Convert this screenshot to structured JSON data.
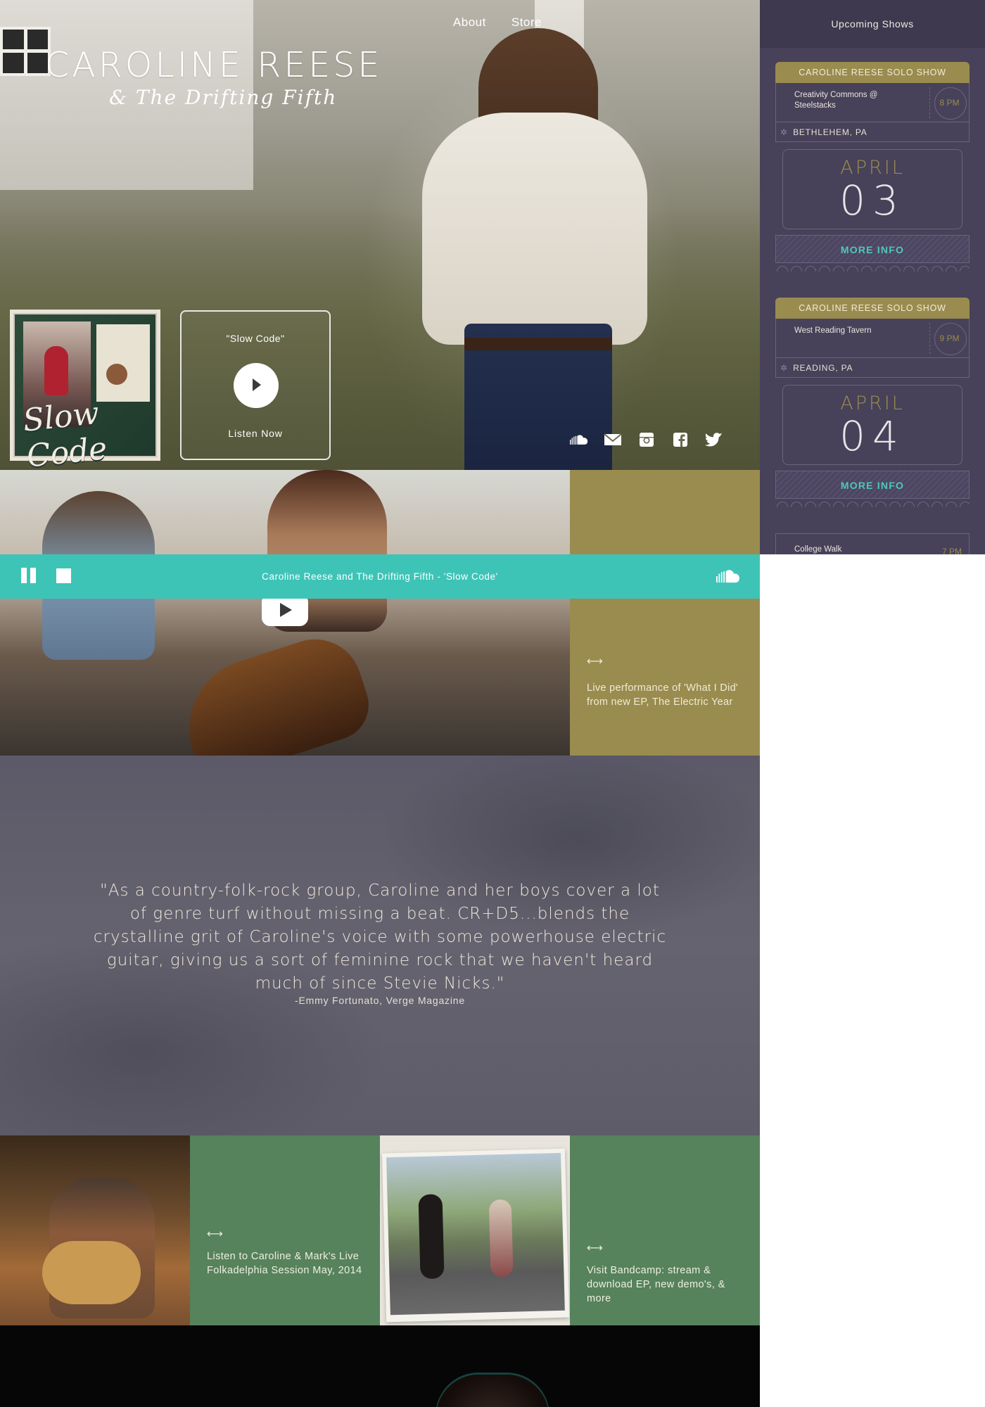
{
  "nav": {
    "about": "About",
    "store": "Store"
  },
  "site": {
    "title": "CAROLINE REESE",
    "subtitle": "& The Drifting Fifth"
  },
  "album": {
    "script_title": "Slow Code"
  },
  "listen": {
    "song": "\"Slow Code\"",
    "cta": "Listen Now"
  },
  "social": [
    "soundcloud-icon",
    "mail-icon",
    "instagram-icon",
    "facebook-icon",
    "twitter-icon"
  ],
  "sidebar": {
    "title": "Upcoming Shows",
    "shows": [
      {
        "band": "CAROLINE REESE SOLO SHOW",
        "venue": "Creativity Commons @ Steelstacks",
        "time": "8 PM",
        "city": "BETHLEHEM, PA",
        "month": "APRIL",
        "day": "03",
        "more": "MORE INFO"
      },
      {
        "band": "CAROLINE REESE SOLO SHOW",
        "venue": "West Reading Tavern",
        "time": "9 PM",
        "city": "READING, PA",
        "month": "APRIL",
        "day": "04",
        "more": "MORE INFO"
      }
    ],
    "partial": {
      "venue": "College Walk",
      "time": "7 PM"
    }
  },
  "player": {
    "track": "Caroline Reese and The Drifting Fifth  -  'Slow Code'"
  },
  "video_caption": {
    "arrow": "⟷",
    "text": "Live performance of 'What I Did' from new EP, The Electric Year"
  },
  "quote": {
    "text": "\"As a country-folk-rock group, Caroline and her boys cover a lot of genre turf without missing a beat.  CR+D5...blends the crystalline grit of Caroline's voice with some powerhouse electric guitar, giving us a sort of feminine rock that we haven't heard much of since Stevie Nicks.\"",
    "source": "-Emmy Fortunato, Verge Magazine"
  },
  "tiles": {
    "folk_session": {
      "arrow": "⟷",
      "text": "Listen to Caroline & Mark's Live Folkadelphia Session May, 2014"
    },
    "bandcamp": {
      "arrow": "⟷",
      "text": "Visit Bandcamp: stream & download EP, new demo's, & more"
    }
  },
  "colors": {
    "olive": "#9a8c4f",
    "teal": "#3dc4b7",
    "sidebar": "#474159",
    "green": "#56825c",
    "quote_bg": "#5e5c69"
  }
}
